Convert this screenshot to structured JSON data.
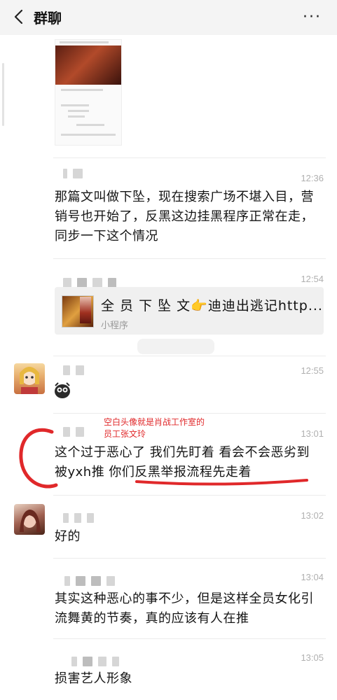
{
  "header": {
    "title": "群聊",
    "more": "···"
  },
  "messages": [
    {
      "time": "",
      "text": ""
    },
    {
      "time": "12:36",
      "text": "那篇文叫做下坠，现在搜索广场不堪入目，营销号也开始了，反黑这边挂黑程序正常在走，同步一下这个情况"
    },
    {
      "time": "12:54",
      "card": {
        "title": "全 员 下 坠  文👉迪迪出逃记http...",
        "label": "小程序"
      }
    },
    {
      "time": "12:55",
      "text": ""
    },
    {
      "time": "13:01",
      "text": "这个过于恶心了 我们先盯着 看会不会恶劣到被yxh推 你们反黑举报流程先走着"
    },
    {
      "time": "13:02",
      "text": "好的"
    },
    {
      "time": "13:04",
      "text": "其实这种恶心的事不少，但是这样全员女化引流舞黄的节奏，真的应该有人在推"
    },
    {
      "time": "13:05",
      "text": "损害艺人形象"
    }
  ],
  "annotation": {
    "line1": "空白头像就是肖战工作室的",
    "line2": "员工张文玲"
  },
  "colors": {
    "annotation": "#e0282a",
    "time": "#b0b0b0",
    "header_bg": "#f4f4f4"
  }
}
